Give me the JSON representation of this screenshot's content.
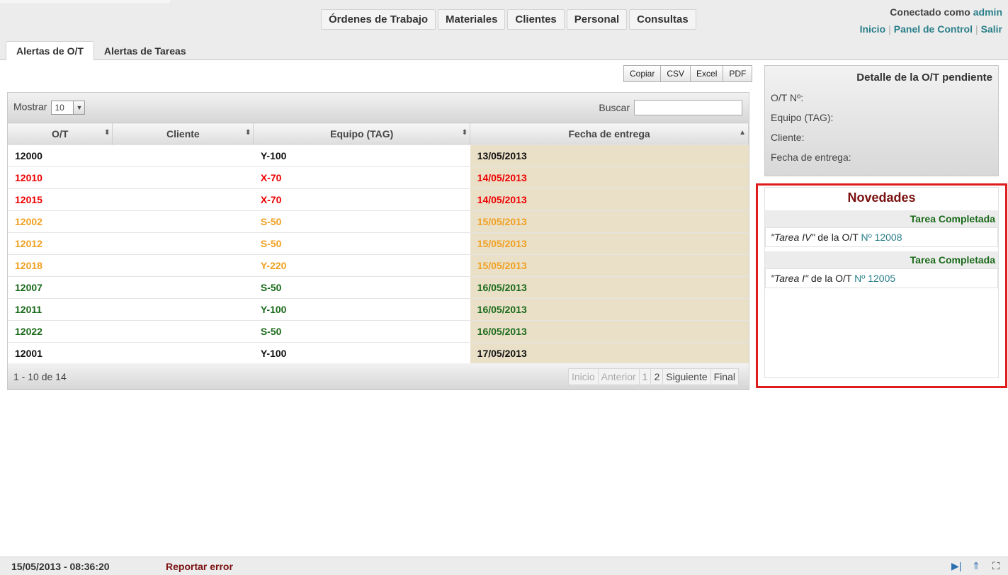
{
  "nav": {
    "items": [
      "Órdenes de Trabajo",
      "Materiales",
      "Clientes",
      "Personal",
      "Consultas"
    ]
  },
  "user": {
    "connected_prefix": "Conectado como",
    "username": "admin",
    "links": [
      "Inicio",
      "Panel de Control",
      "Salir"
    ]
  },
  "tabs": [
    "Alertas de O/T",
    "Alertas de Tareas"
  ],
  "export": [
    "Copiar",
    "CSV",
    "Excel",
    "PDF"
  ],
  "table": {
    "show_label": "Mostrar",
    "show_value": "10",
    "search_label": "Buscar",
    "headers": [
      "O/T",
      "Cliente",
      "Equipo (TAG)",
      "Fecha de entrega"
    ],
    "rows": [
      {
        "ot": "12000",
        "cliente": "",
        "equipo": "Y-100",
        "fecha": "13/05/2013",
        "color": "black"
      },
      {
        "ot": "12010",
        "cliente": "",
        "equipo": "X-70",
        "fecha": "14/05/2013",
        "color": "red"
      },
      {
        "ot": "12015",
        "cliente": "",
        "equipo": "X-70",
        "fecha": "14/05/2013",
        "color": "red"
      },
      {
        "ot": "12002",
        "cliente": "",
        "equipo": "S-50",
        "fecha": "15/05/2013",
        "color": "orange"
      },
      {
        "ot": "12012",
        "cliente": "",
        "equipo": "S-50",
        "fecha": "15/05/2013",
        "color": "orange"
      },
      {
        "ot": "12018",
        "cliente": "",
        "equipo": "Y-220",
        "fecha": "15/05/2013",
        "color": "orange"
      },
      {
        "ot": "12007",
        "cliente": "",
        "equipo": "S-50",
        "fecha": "16/05/2013",
        "color": "green"
      },
      {
        "ot": "12011",
        "cliente": "",
        "equipo": "Y-100",
        "fecha": "16/05/2013",
        "color": "green"
      },
      {
        "ot": "12022",
        "cliente": "",
        "equipo": "S-50",
        "fecha": "16/05/2013",
        "color": "green"
      },
      {
        "ot": "12001",
        "cliente": "",
        "equipo": "Y-100",
        "fecha": "17/05/2013",
        "color": "black"
      }
    ],
    "info": "1 - 10 de 14",
    "pager": [
      "Inicio",
      "Anterior",
      "1",
      "2",
      "Siguiente",
      "Final"
    ]
  },
  "detail": {
    "title": "Detalle de la O/T pendiente",
    "fields": [
      "O/T Nº:",
      "Equipo (TAG):",
      "Cliente:",
      "Fecha de entrega:"
    ]
  },
  "novedades": {
    "title": "Novedades",
    "items": [
      {
        "head": "Tarea Completada",
        "task": "\"Tarea IV\"",
        "middle": " de la O/T ",
        "link": "Nº 12008"
      },
      {
        "head": "Tarea Completada",
        "task": "\"Tarea I\"",
        "middle": " de la O/T ",
        "link": "Nº 12005"
      }
    ]
  },
  "footer": {
    "datetime": "15/05/2013 - 08:36:20",
    "report": "Reportar error"
  }
}
